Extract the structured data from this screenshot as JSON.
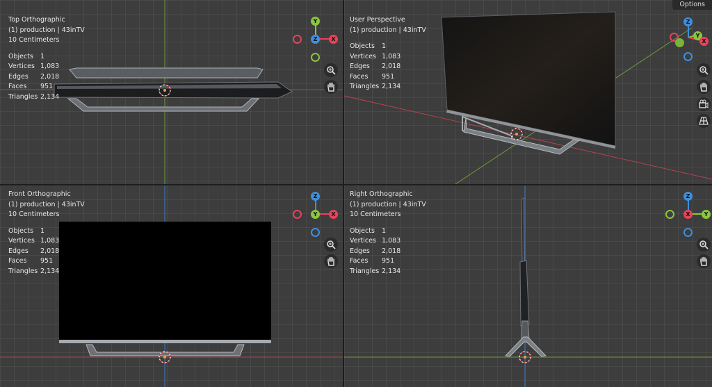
{
  "header": {
    "options_label": "Options",
    "icons": [
      "select-box-icon",
      "select-mode-icon"
    ]
  },
  "viewports": [
    {
      "view": "Top Orthographic",
      "collection": "(1) production | 43inTV",
      "scale": "10 Centimeters",
      "stats": [
        [
          "Objects",
          "1"
        ],
        [
          "Vertices",
          "1,083"
        ],
        [
          "Edges",
          "2,018"
        ],
        [
          "Faces",
          "951"
        ],
        [
          "Triangles",
          "2,134"
        ]
      ],
      "gizmo_axes": [
        "Y",
        "Z",
        "X"
      ]
    },
    {
      "view": "User Perspective",
      "collection": "(1) production | 43inTV",
      "scale": "",
      "stats": [
        [
          "Objects",
          "1"
        ],
        [
          "Vertices",
          "1,083"
        ],
        [
          "Edges",
          "2,018"
        ],
        [
          "Faces",
          "951"
        ],
        [
          "Triangles",
          "2,134"
        ]
      ],
      "gizmo_axes": [
        "Z",
        "Y",
        "X"
      ]
    },
    {
      "view": "Front Orthographic",
      "collection": "(1) production | 43inTV",
      "scale": "10 Centimeters",
      "stats": [
        [
          "Objects",
          "1"
        ],
        [
          "Vertices",
          "1,083"
        ],
        [
          "Edges",
          "2,018"
        ],
        [
          "Faces",
          "951"
        ],
        [
          "Triangles",
          "2,134"
        ]
      ],
      "gizmo_axes": [
        "Z",
        "Y",
        "X"
      ]
    },
    {
      "view": "Right Orthographic",
      "collection": "(1) production | 43inTV",
      "scale": "10 Centimeters",
      "stats": [
        [
          "Objects",
          "1"
        ],
        [
          "Vertices",
          "1,083"
        ],
        [
          "Edges",
          "2,018"
        ],
        [
          "Faces",
          "951"
        ],
        [
          "Triangles",
          "2,134"
        ]
      ],
      "gizmo_axes": [
        "Z",
        "X",
        "Y"
      ]
    }
  ],
  "colors": {
    "viewport_bg": "#3d3d3d",
    "axis_x": "#e8425a",
    "axis_y": "#8bc53f",
    "axis_z": "#3f8fdd",
    "x_line": "#b3434d",
    "y_line": "#6e9a3a",
    "z_line": "#3d79c2"
  }
}
